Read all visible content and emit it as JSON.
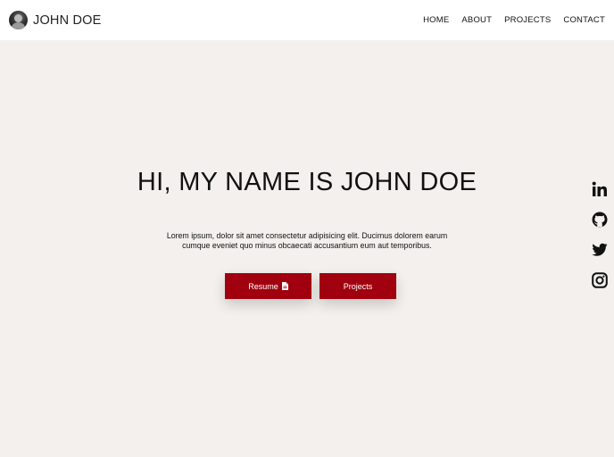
{
  "navbar": {
    "brand_name": "JOHN DOE",
    "links": [
      "HOME",
      "ABOUT",
      "PROJECTS",
      "CONTACT"
    ]
  },
  "hero": {
    "title": "HI, MY NAME IS JOHN DOE",
    "line1": "Lorem ipsum, dolor sit amet consectetur adipisicing elit. Ducimus dolorem earum",
    "line2": "cumque eveniet quo minus obcaecati accusantium eum aut temporibus.",
    "resume_label": "Resume",
    "projects_label": "Projects"
  },
  "social": {
    "icons": [
      "linkedin-icon",
      "github-icon",
      "twitter-icon",
      "instagram-icon"
    ]
  },
  "colors": {
    "accent": "#a1000f",
    "background": "#f3f0ed",
    "navbar": "#ffffff"
  }
}
